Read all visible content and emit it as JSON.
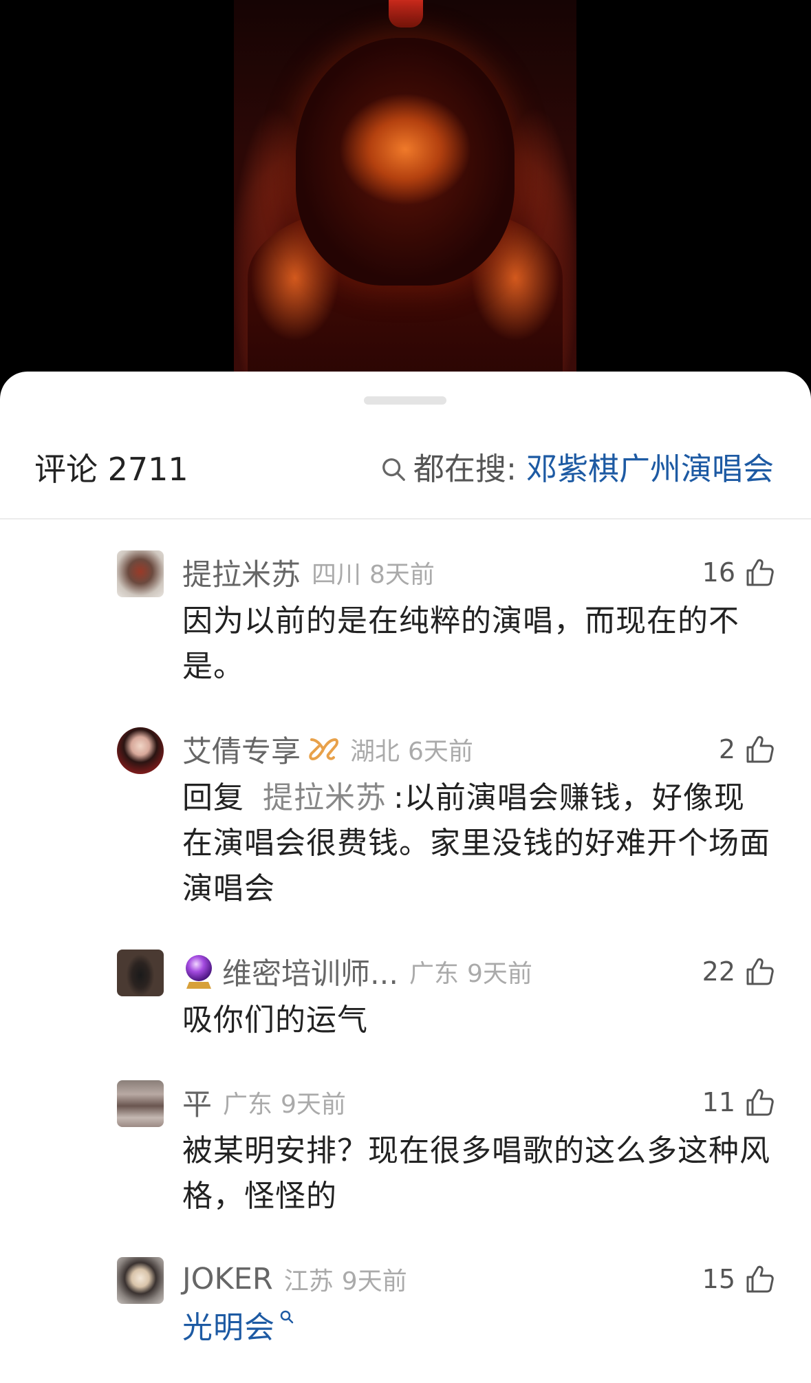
{
  "header": {
    "comments_label": "评论 2711",
    "hot_search_prefix": "都在搜:",
    "hot_search_keyword": "邓紫棋广州演唱会"
  },
  "comments": [
    {
      "user": "提拉米苏",
      "location": "四川",
      "time": "8天前",
      "likes": "16",
      "text": "因为以前的是在纯粹的演唱，而现在的不是。"
    },
    {
      "user": "艾倩专享",
      "badge": "vip-ribbon-icon",
      "location": "湖北",
      "time": "6天前",
      "likes": "2",
      "reply_prefix": "回复",
      "reply_to": "提拉米苏",
      "text": ":以前演唱会赚钱，好像现在演唱会很费钱。家里没钱的好难开个场面演唱会"
    },
    {
      "user": "维密培训师...",
      "badge": "crystal-ball-icon",
      "location": "广东",
      "time": "9天前",
      "likes": "22",
      "text": "吸你们的运气"
    },
    {
      "user": "平",
      "location": "广东",
      "time": "9天前",
      "likes": "11",
      "text": "被某明安排？现在很多唱歌的这么多这种风格，怪怪的"
    },
    {
      "user": "JOKER",
      "location": "江苏",
      "time": "9天前",
      "likes": "15",
      "text": "光明会"
    }
  ],
  "colors": {
    "link_blue": "#1d5aa3",
    "username_gray": "#666666",
    "meta_gray": "#aaaaaa",
    "text_dark": "#222222"
  }
}
